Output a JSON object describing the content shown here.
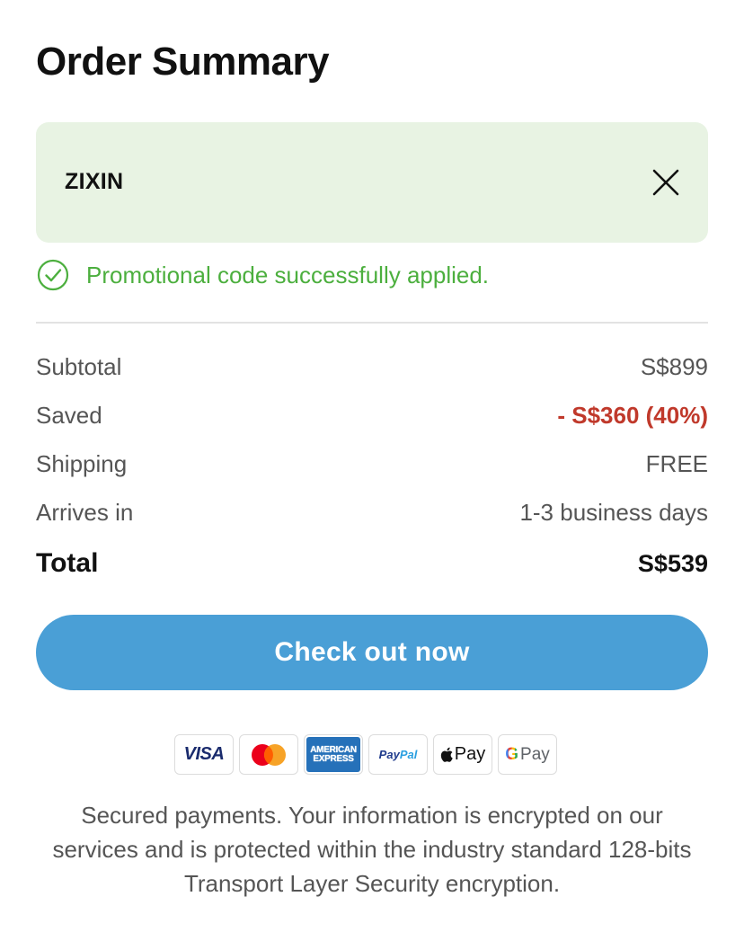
{
  "page": {
    "title": "Order Summary"
  },
  "promo": {
    "code": "ZIXIN",
    "status_text": "Promotional code successfully applied.",
    "status_color": "#4caf3e",
    "box_color": "#e8f3e3"
  },
  "summary": {
    "rows": [
      {
        "label": "Subtotal",
        "value": "S$899"
      },
      {
        "label": "Saved",
        "value": "- S$360 (40%)"
      },
      {
        "label": "Shipping",
        "value": "FREE"
      },
      {
        "label": "Arrives in",
        "value": "1-3 business days"
      }
    ],
    "total": {
      "label": "Total",
      "value": "S$539"
    },
    "saved_color": "#c0392b"
  },
  "checkout": {
    "label": "Check out now",
    "color": "#4a9fd6"
  },
  "payments": {
    "visa": "VISA",
    "amex_line1": "AMERICAN",
    "amex_line2": "EXPRESS",
    "paypal_pay": "Pay",
    "paypal_pal": "Pal",
    "applepay": "Pay",
    "gpay_g": "G",
    "gpay": "Pay"
  },
  "footer": {
    "secure_note": "Secured payments. Your information is encrypted on our services and is protected within the industry standard 128-bits Transport Layer Security encryption."
  }
}
